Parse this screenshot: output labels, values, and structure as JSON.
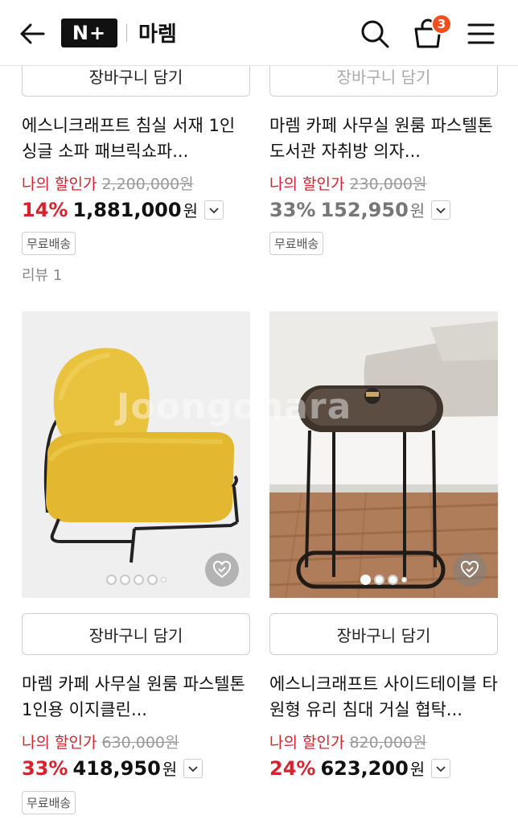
{
  "header": {
    "logo": "N+",
    "brand": "마렘",
    "cart_count": "3"
  },
  "watermark": "Joongonara",
  "products": [
    {
      "cart_label": "장바구니 담기",
      "title": "에스니크래프트 침실 서재 1인 싱글 소파 패브릭쇼파...",
      "member_label": "나의 할인가",
      "original_price": "2,200,000원",
      "discount": "14%",
      "price": "1,881,000",
      "won": "원",
      "tag": "무료배송",
      "review": "리뷰 1"
    },
    {
      "cart_label": "장바구니 담기",
      "title": "마렘 카페 사무실 원룸 파스텔톤 도서관 자취방 의자...",
      "member_label": "나의 할인가",
      "original_price": "230,000원",
      "discount": "33%",
      "price": "152,950",
      "won": "원",
      "tag": "무료배송"
    },
    {
      "cart_label": "장바구니 담기",
      "title": "마렘 카페 사무실 원룸 파스텔톤 1인용 이지클린...",
      "member_label": "나의 할인가",
      "original_price": "630,000원",
      "discount": "33%",
      "price": "418,950",
      "won": "원",
      "tag": "무료배송",
      "image_icon": "yellow-lounge-chair"
    },
    {
      "cart_label": "장바구니 담기",
      "title": "에스니크래프트 사이드테이블 타원형 유리 침대 거실 협탁...",
      "member_label": "나의 할인가",
      "original_price": "820,000원",
      "discount": "24%",
      "price": "623,200",
      "won": "원",
      "image_icon": "oval-side-table"
    }
  ],
  "colors": {
    "accent": "#d6222f",
    "badge": "#f04e1e",
    "chair": "#e9c23e"
  }
}
